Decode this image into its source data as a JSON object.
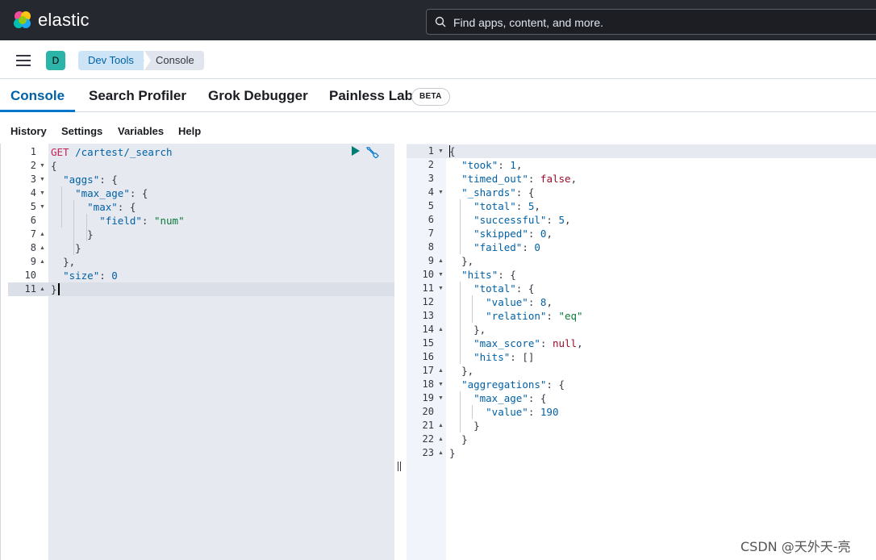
{
  "header": {
    "brand": "elastic",
    "search_placeholder": "Find apps, content, and more."
  },
  "breadcrumb": {
    "avatar_letter": "D",
    "items": [
      "Dev Tools",
      "Console"
    ]
  },
  "tabs": [
    {
      "label": "Console",
      "active": true
    },
    {
      "label": "Search Profiler"
    },
    {
      "label": "Grok Debugger"
    },
    {
      "label": "Painless Lab",
      "badge": "BETA"
    }
  ],
  "subnav": [
    "History",
    "Settings",
    "Variables",
    "Help"
  ],
  "request": {
    "line_numbers": [
      "1",
      "2",
      "3",
      "4",
      "5",
      "6",
      "7",
      "8",
      "9",
      "10",
      "11"
    ],
    "method": "GET",
    "path": "/cartest/_search",
    "lines": [
      "{",
      "  \"aggs\": {",
      "    \"max_age\": {",
      "      \"max\": {",
      "        \"field\": \"num\"",
      "      }",
      "    }",
      "  },",
      "  \"size\": 0",
      "}"
    ]
  },
  "response": {
    "line_numbers": [
      "1",
      "2",
      "3",
      "4",
      "5",
      "6",
      "7",
      "8",
      "9",
      "10",
      "11",
      "12",
      "13",
      "14",
      "15",
      "16",
      "17",
      "18",
      "19",
      "20",
      "21",
      "22",
      "23"
    ],
    "lines": [
      "{",
      "  \"took\": 1,",
      "  \"timed_out\": false,",
      "  \"_shards\": {",
      "    \"total\": 5,",
      "    \"successful\": 5,",
      "    \"skipped\": 0,",
      "    \"failed\": 0",
      "  },",
      "  \"hits\": {",
      "    \"total\": {",
      "      \"value\": 8,",
      "      \"relation\": \"eq\"",
      "    },",
      "    \"max_score\": null,",
      "    \"hits\": []",
      "  },",
      "  \"aggregations\": {",
      "    \"max_age\": {",
      "      \"value\": 190",
      "    }",
      "  }",
      "}"
    ]
  },
  "watermark": "CSDN @天外天-亮",
  "colors": {
    "header_bg": "#25282f",
    "accent": "#0077cc",
    "avatar": "#2bb4a7",
    "run": "#017d73"
  }
}
